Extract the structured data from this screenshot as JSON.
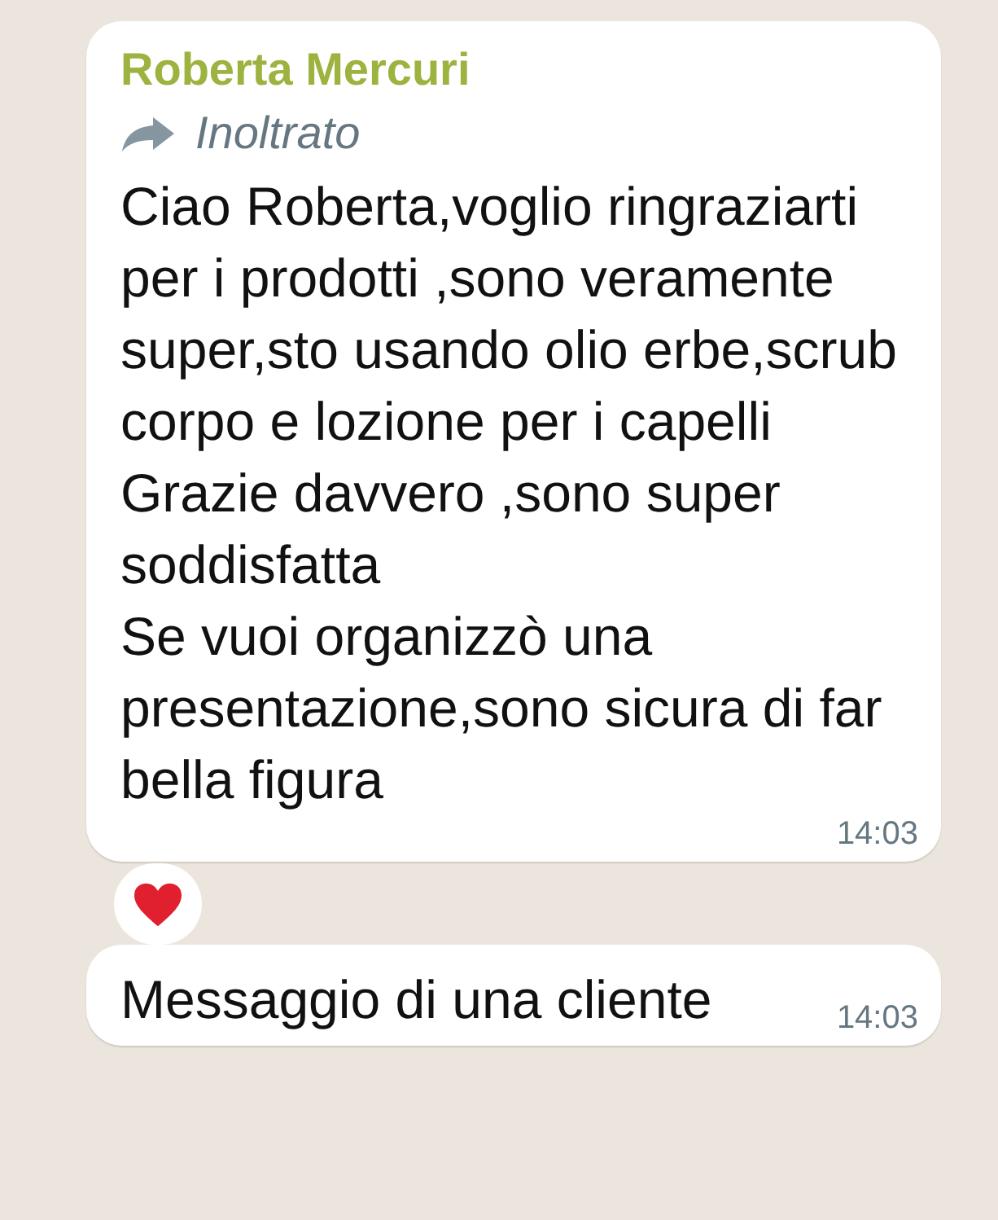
{
  "messages": [
    {
      "sender": "Roberta Mercuri",
      "forwarded_label": "Inoltrato",
      "paragraphs": [
        "Ciao Roberta,voglio ringraziarti per i prodotti ,sono veramente super,sto usando olio erbe,scrub corpo e lozione per i capelli",
        "Grazie davvero ,sono super soddisfatta",
        "Se vuoi organizzò una presentazione,sono sicura di far bella figura"
      ],
      "time": "14:03",
      "reaction": true
    },
    {
      "paragraphs": [
        "Messaggio di una cliente"
      ],
      "time": "14:03",
      "reaction": false
    }
  ]
}
